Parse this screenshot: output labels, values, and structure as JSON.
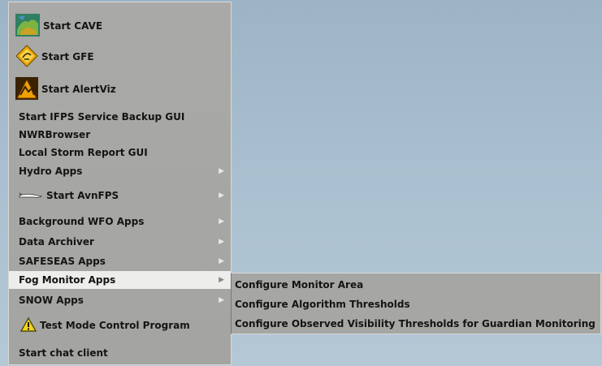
{
  "menu": {
    "items": [
      {
        "label": "Start CAVE",
        "icon": "cave-icon"
      },
      {
        "label": "Start GFE",
        "icon": "gfe-icon"
      },
      {
        "label": "Start AlertViz",
        "icon": "alertviz-icon"
      },
      {
        "label": "Start IFPS Service Backup GUI"
      },
      {
        "label": "NWRBrowser"
      },
      {
        "label": "Local Storm Report GUI"
      },
      {
        "label": "Hydro Apps",
        "has_submenu": true
      },
      {
        "label": "Start AvnFPS",
        "icon": "avnfps-icon",
        "has_submenu": true
      },
      {
        "label": "Background WFO Apps",
        "has_submenu": true
      },
      {
        "label": "Data Archiver",
        "has_submenu": true
      },
      {
        "label": "SAFESEAS Apps",
        "has_submenu": true
      },
      {
        "label": "Fog Monitor Apps",
        "has_submenu": true,
        "selected": true
      },
      {
        "label": "SNOW Apps",
        "has_submenu": true
      },
      {
        "label": "Test Mode Control Program",
        "icon": "warning-icon"
      },
      {
        "label": "Start chat client"
      }
    ]
  },
  "submenu": {
    "items": [
      {
        "label": "Configure Monitor Area"
      },
      {
        "label": "Configure Algorithm Thresholds"
      },
      {
        "label": "Configure Observed Visibility Thresholds for Guardian Monitoring"
      }
    ]
  },
  "colors": {
    "desktop": "#a9bfcf",
    "menu_bg": "#a6a6a4",
    "selected_bg": "#ededeb",
    "warning_yellow": "#f2d21b"
  }
}
